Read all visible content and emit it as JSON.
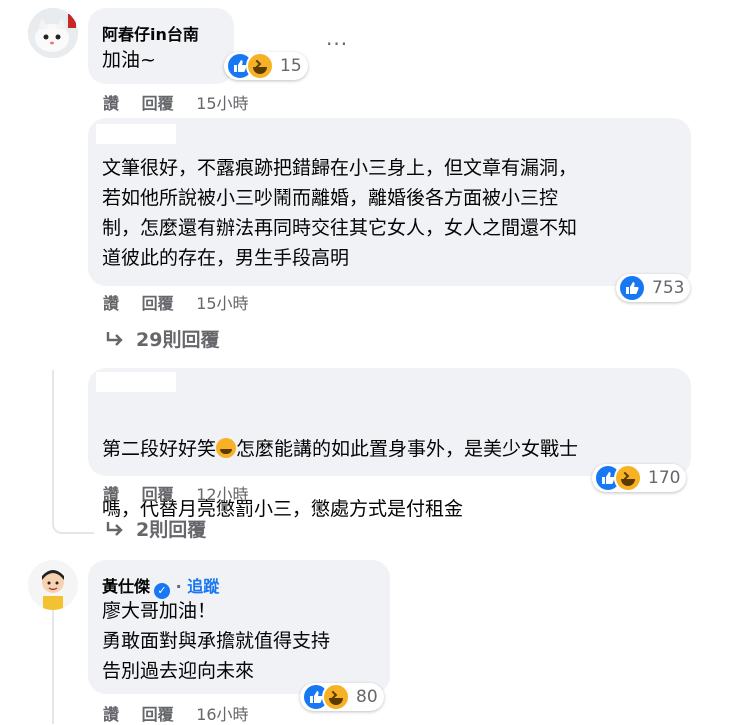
{
  "comments": [
    {
      "author": "阿春仔in台南",
      "text": "加油~",
      "reactions": {
        "count": "15",
        "types": [
          "like-icon",
          "haha-icon"
        ]
      },
      "actions": {
        "like": "讚",
        "reply": "回覆",
        "time": "15小時"
      },
      "more": "···"
    },
    {
      "author": "",
      "text": "文筆很好，不露痕跡把錯歸在小三身上，但文章有漏洞，\n若如他所說被小三吵鬧而離婚，離婚後各方面被小三控\n制，怎麼還有辦法再同時交往其它女人，女人之間還不知\n道彼此的存在，男生手段高明",
      "reactions": {
        "count": "753",
        "types": [
          "like-icon"
        ]
      },
      "actions": {
        "like": "讚",
        "reply": "回覆",
        "time": "15小時"
      },
      "replies": "29則回覆"
    },
    {
      "author": "",
      "text_a": "第二段好好笑",
      "text_b": "怎麼能講的如此置身事外，是美少女戰士",
      "text_c": "嗎，代替月亮懲罰小三，懲處方式是付租金",
      "reactions": {
        "count": "170",
        "types": [
          "like-icon",
          "haha-icon"
        ]
      },
      "actions": {
        "like": "讚",
        "reply": "回覆",
        "time": "12小時"
      },
      "replies": "2則回覆"
    },
    {
      "author": "黃仕傑",
      "verified": "✓",
      "follow": "追蹤",
      "text": "廖大哥加油！\n勇敢面對與承擔就值得支持\n告別過去迎向未來",
      "reactions": {
        "count": "80",
        "types": [
          "like-icon",
          "haha-icon"
        ]
      },
      "actions": {
        "like": "讚",
        "reply": "回覆",
        "time": "16小時"
      }
    }
  ]
}
